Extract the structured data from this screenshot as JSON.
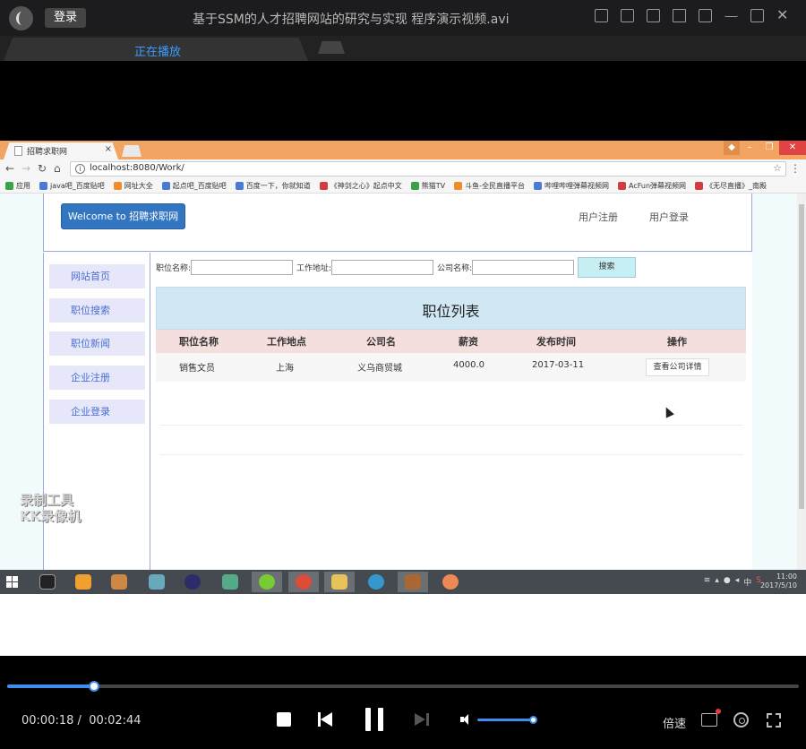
{
  "player": {
    "login_label": "登录",
    "title": "基于SSM的人才招聘网站的研究与实现 程序演示视频.avi",
    "tab_label": "正在播放",
    "time_current": "00:00:18",
    "time_separator": "/",
    "time_total": "00:02:44",
    "progress_fraction": 0.11,
    "volume_fraction": 1.0,
    "speed_label": "倍速"
  },
  "browser": {
    "tab_title": "招聘求职网",
    "tab_close": "×",
    "url": "localhost:8080/Work/",
    "bookmarks": [
      "应用",
      "java吧_百度贴吧",
      "网址大全",
      "起点吧_百度贴吧",
      "百度一下，你就知道",
      "《神剑之心》起点中文",
      "熊猫TV",
      "斗鱼-全民直播平台",
      "哔哩哔哩弹幕视频网",
      "AcFun弹幕视频网",
      "《无尽直播》_南殿"
    ]
  },
  "site": {
    "welcome": "Welcome to 招聘求职网",
    "register_link": "用户注册",
    "login_link": "用户登录",
    "sidebar": [
      "网站首页",
      "职位搜索",
      "职位新闻",
      "企业注册",
      "企业登录"
    ],
    "search": {
      "job_name_label": "职位名称:",
      "location_label": "工作地址:",
      "company_label": "公司名称:",
      "button": "搜索"
    },
    "list_title": "职位列表",
    "columns": [
      "职位名称",
      "工作地点",
      "公司名",
      "薪资",
      "发布时间",
      "操作"
    ],
    "rows": [
      {
        "job": "销售文员",
        "location": "上海",
        "company": "义乌商贸城",
        "salary": "4000.0",
        "date": "2017-03-11",
        "action": "查看公司详情"
      }
    ],
    "watermark_line1": "录制工具",
    "watermark_line2": "KK录像机"
  },
  "taskbar": {
    "tray_text": "中",
    "clock_time": "11:00",
    "clock_date": "2017/5/10"
  },
  "colors": {
    "accent": "#3c8ef0",
    "welcome_bg": "#3275c0",
    "list_header_bg": "#d0e8f4",
    "table_header_bg": "#f5dede",
    "sidebar_item_bg": "#e6e7f8"
  }
}
